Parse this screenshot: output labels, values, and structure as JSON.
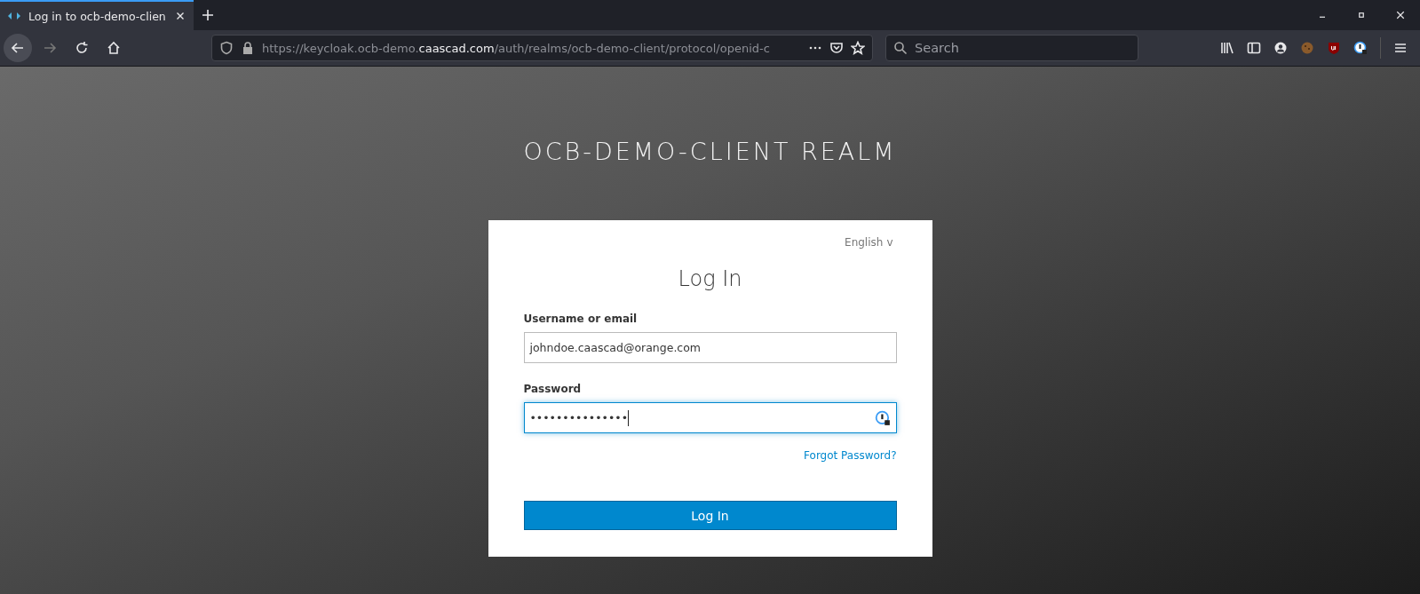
{
  "browser": {
    "tab": {
      "title": "Log in to ocb-demo-clien",
      "selected": true
    },
    "url": {
      "prefix": "https://keycloak.ocb-demo.",
      "domain": "caascad.com",
      "path": "/auth/realms/ocb-demo-client/protocol/openid-c"
    },
    "search": {
      "placeholder": "Search"
    }
  },
  "page": {
    "realm_title": "OCB-DEMO-CLIENT REALM",
    "card": {
      "language": "English",
      "language_caret": "v",
      "title": "Log In",
      "fields": [
        {
          "label": "Username or email",
          "value": "johndoe.caascad@orange.com",
          "focused": false,
          "kind": "text"
        },
        {
          "label": "Password",
          "value": "•••••••••••••••",
          "focused": true,
          "kind": "password"
        }
      ],
      "forgot_link": "Forgot Password?",
      "submit": "Log In"
    }
  }
}
